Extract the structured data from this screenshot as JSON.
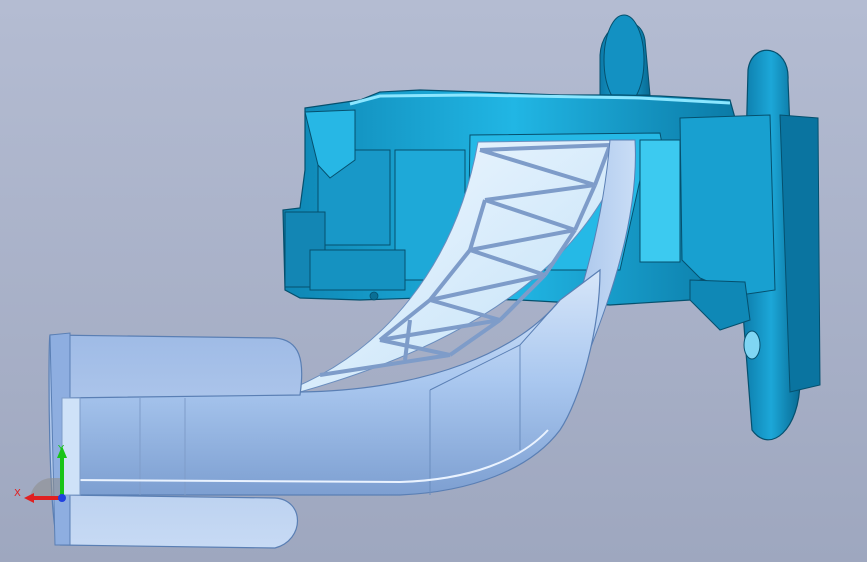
{
  "window": {
    "background_top": "#b4bcd2",
    "background_bottom": "#9ea7bf"
  },
  "model": {
    "housing_color": "#1aa6d6",
    "housing_dark": "#0a6f95",
    "housing_light": "#55d0f2",
    "pedal_arm_color": "#a9c7ef",
    "pedal_arm_light": "#cfe2f8",
    "pedal_arm_dark": "#6f93c7"
  },
  "triad": {
    "x_label": "X",
    "y_label": "Y",
    "x_color": "#e02020",
    "y_color": "#18c418",
    "z_color": "#2040e0"
  }
}
